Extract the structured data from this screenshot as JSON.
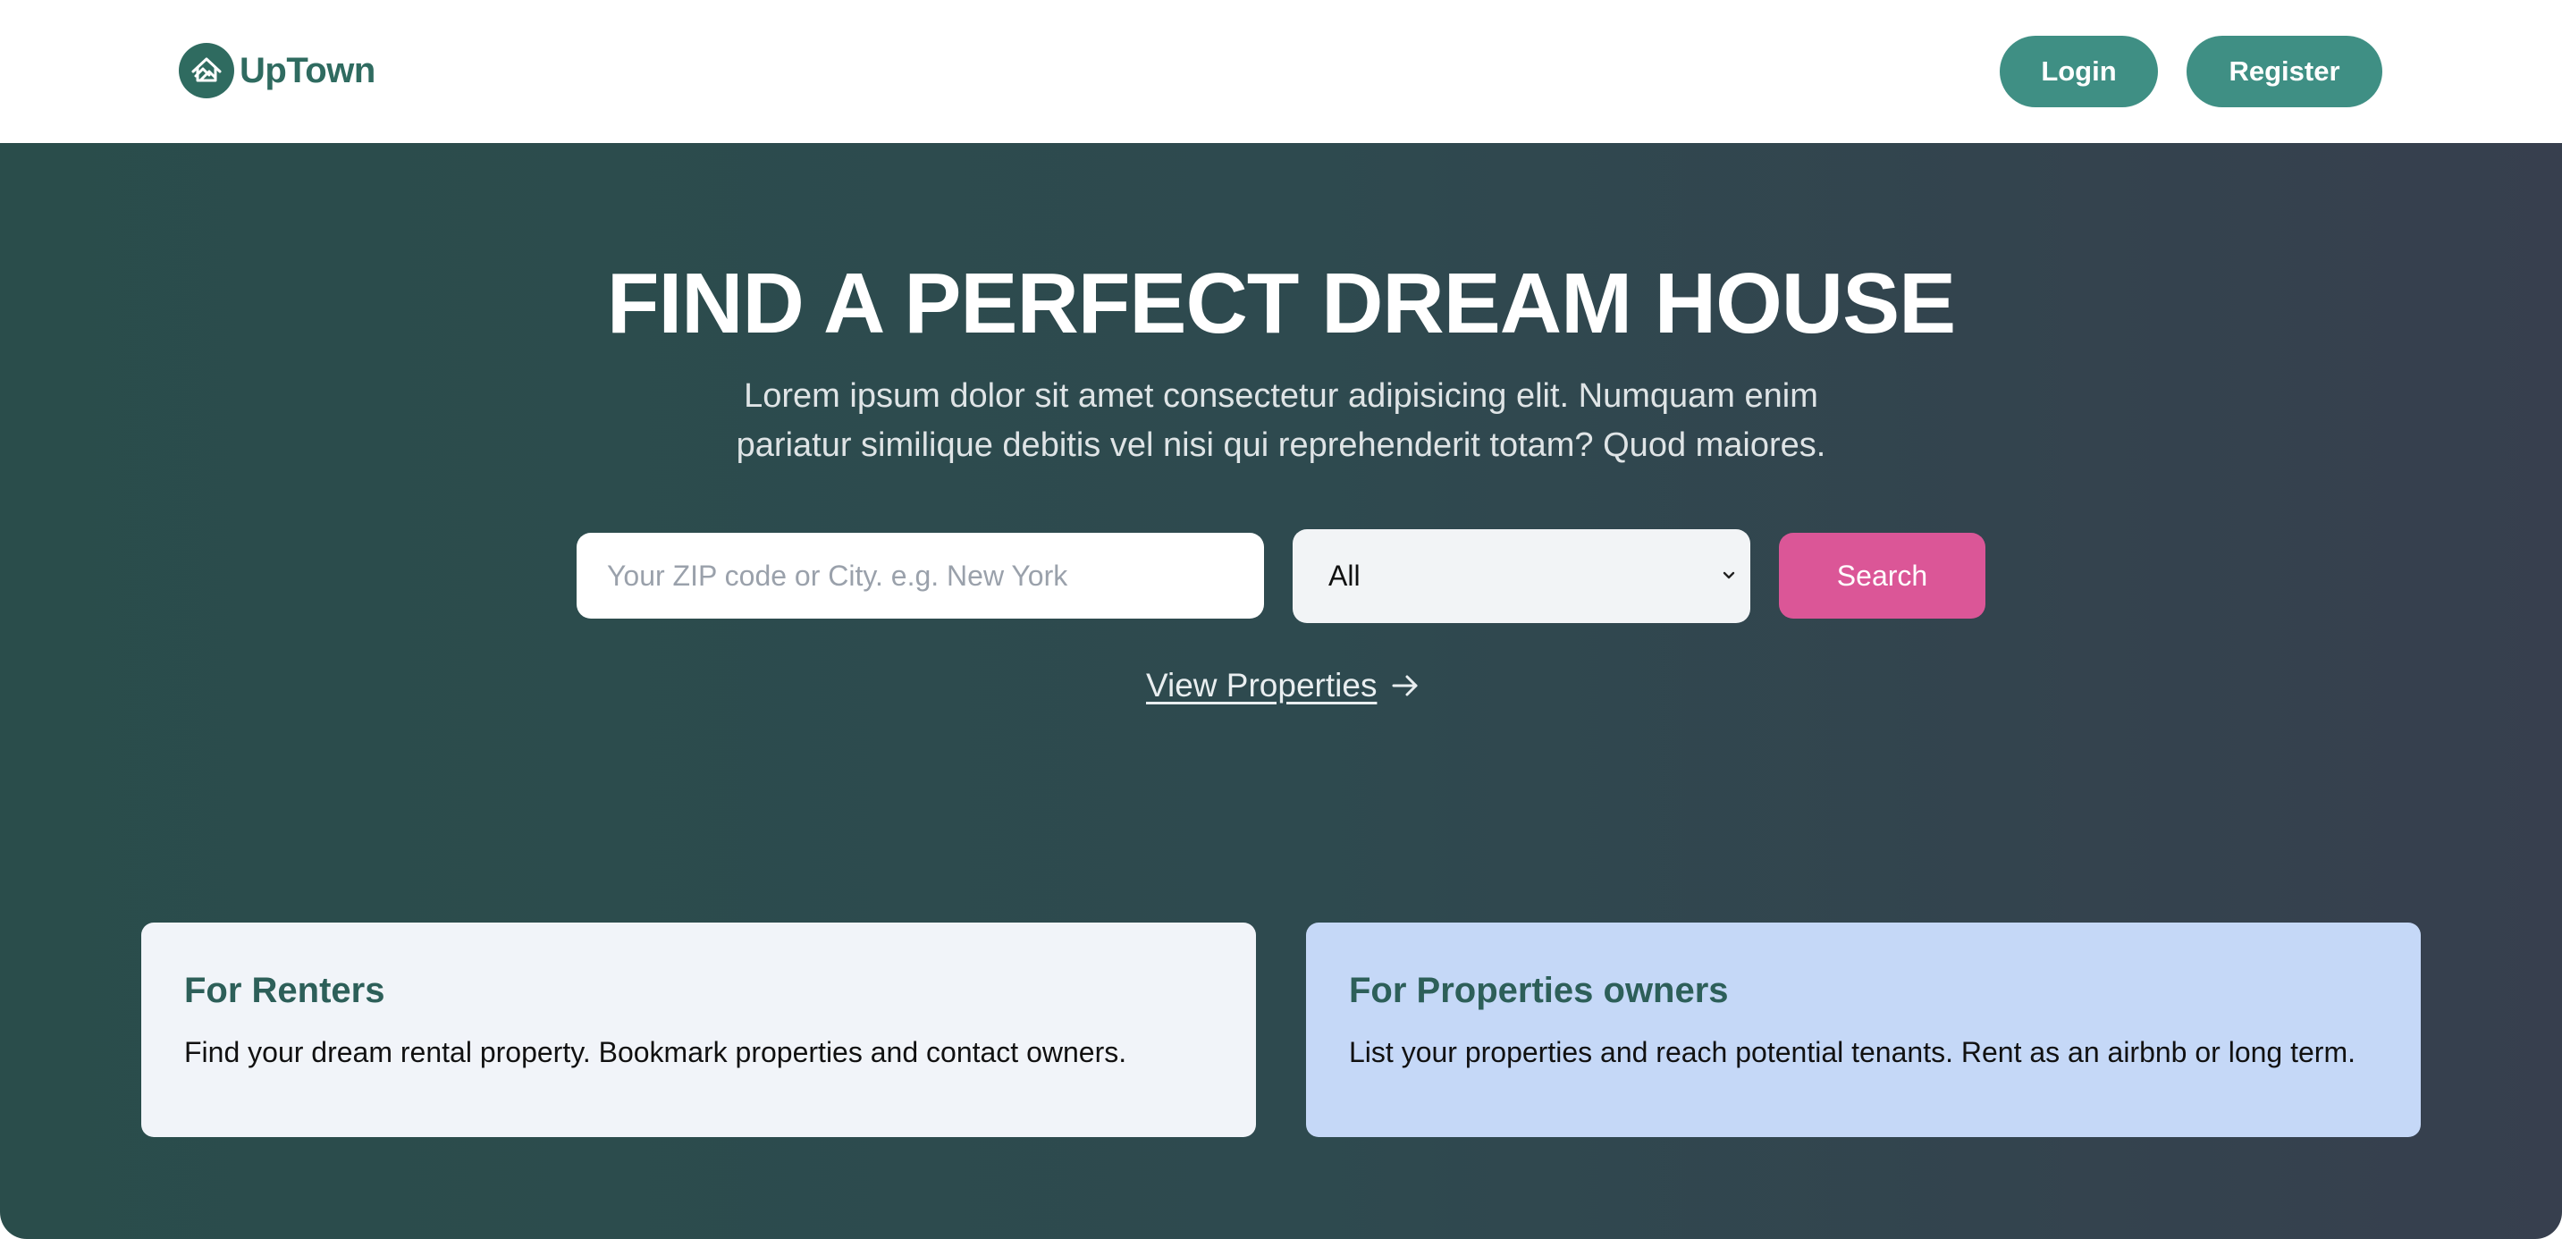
{
  "navbar": {
    "brand": "UpTown",
    "login_label": "Login",
    "register_label": "Register"
  },
  "hero": {
    "title": "FIND A PERFECT DREAM HOUSE",
    "subtitle": "Lorem ipsum dolor sit amet consectetur adipisicing elit. Numquam enim pariatur similique debitis vel nisi qui reprehenderit totam? Quod maiores.",
    "search": {
      "placeholder": "Your ZIP code or City. e.g. New York",
      "value": "",
      "select_value": "All",
      "button_label": "Search"
    },
    "view_link": "View Properties"
  },
  "cards": [
    {
      "title": "For Renters",
      "text": "Find your dream rental property. Bookmark properties and contact owners."
    },
    {
      "title": "For Properties owners",
      "text": "List your properties and reach potential tenants. Rent as an airbnb or long term."
    }
  ],
  "colors": {
    "brand": "#2f6b60",
    "nav_button": "#3f8f84",
    "search_button": "#db5697",
    "card_renters_bg": "#f1f4f9",
    "card_owners_bg": "#c5d8f7"
  },
  "icons": {
    "logo": "house-hands-logo-icon",
    "select_chevron": "chevron-down-icon",
    "view_arrow": "arrow-right-icon"
  }
}
